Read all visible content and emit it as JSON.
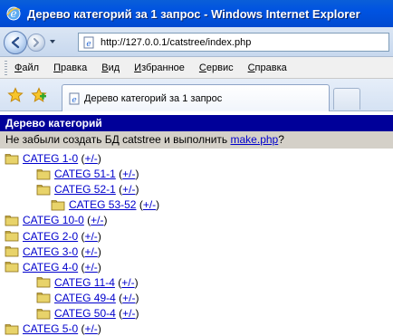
{
  "window": {
    "title": "Дерево категорий за 1 запрос - Windows Internet Explorer"
  },
  "address": {
    "url": "http://127.0.0.1/catstree/index.php"
  },
  "menu": {
    "items": [
      {
        "u": "Ф",
        "rest": "айл"
      },
      {
        "u": "П",
        "rest": "равка"
      },
      {
        "u": "В",
        "rest": "ид"
      },
      {
        "u": "И",
        "rest": "збранное"
      },
      {
        "u": "С",
        "rest": "ервис"
      },
      {
        "u": "С",
        "rest": "правка"
      }
    ]
  },
  "tab": {
    "label": "Дерево категорий за 1 запрос"
  },
  "page": {
    "header": "Дерево категорий",
    "notice_prefix": "Не забыли создать БД catstree и выполнить ",
    "notice_link": "make.php",
    "notice_suffix": "?",
    "toggle_label": "+/-",
    "tree": [
      {
        "label": "CATEG 1-0",
        "level": 0
      },
      {
        "label": "CATEG 51-1",
        "level": 1
      },
      {
        "label": "CATEG 52-1",
        "level": 1
      },
      {
        "label": "CATEG 53-52",
        "level": 2
      },
      {
        "label": "CATEG 10-0",
        "level": 0
      },
      {
        "label": "CATEG 2-0",
        "level": 0
      },
      {
        "label": "CATEG 3-0",
        "level": 0
      },
      {
        "label": "CATEG 4-0",
        "level": 0
      },
      {
        "label": "CATEG 11-4",
        "level": 1
      },
      {
        "label": "CATEG 49-4",
        "level": 1
      },
      {
        "label": "CATEG 50-4",
        "level": 1
      },
      {
        "label": "CATEG 5-0",
        "level": 0
      }
    ]
  },
  "colors": {
    "titlebar": "#0053e1",
    "page_header": "#000099",
    "link": "#0000cc",
    "folder": "#e8d36a"
  }
}
